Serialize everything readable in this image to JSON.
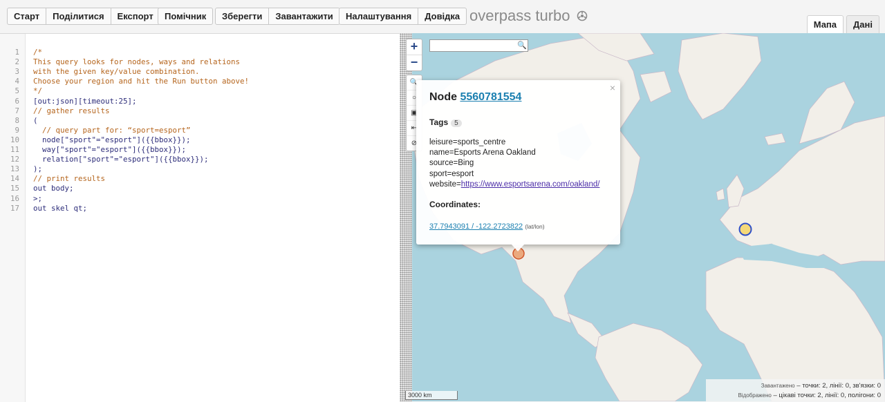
{
  "toolbar": {
    "groups": [
      {
        "buttons": [
          "Старт",
          "Поділитися",
          "Експорт"
        ]
      },
      {
        "buttons": [
          "Помічник"
        ]
      },
      {
        "buttons": [
          "Зберегти",
          "Завантажити"
        ]
      },
      {
        "buttons": [
          "Налаштування",
          "Довідка"
        ]
      }
    ]
  },
  "app": {
    "logo": "overpass turbo",
    "logo_icon": "gear-icon"
  },
  "tabs": {
    "map": "Мапа",
    "data": "Дані",
    "active": "map"
  },
  "editor": {
    "line_numbers": [
      "1",
      "2",
      "3",
      "4",
      "5",
      "6",
      "7",
      "8",
      "9",
      "10",
      "11",
      "12",
      "13",
      "14",
      "15",
      "16",
      "17"
    ],
    "lines": [
      "/*",
      "This query looks for nodes, ways and relations",
      "with the given key/value combination.",
      "Choose your region and hit the Run button above!",
      "*/",
      "[out:json][timeout:25];",
      "// gather results",
      "(",
      "  // query part for: “sport=esport”",
      "  node[\"sport\"=\"esport\"]({{bbox}});",
      "  way[\"sport\"=\"esport\"]({{bbox}});",
      "  relation[\"sport\"=\"esport\"]({{bbox}});",
      ");",
      "// print results",
      "out body;",
      ">;",
      "out skel qt;"
    ]
  },
  "map": {
    "zoom_in": "+",
    "zoom_out": "−",
    "search": {
      "value": "",
      "placeholder": ""
    },
    "tools": [
      "search-icon",
      "locate-icon",
      "image-icon",
      "fit-icon",
      "clear-icon"
    ],
    "scale": "3000 km",
    "popup": {
      "title_prefix": "Node",
      "node_id": "5560781554",
      "tags_label": "Tags",
      "tags_count": "5",
      "tags": [
        "leisure=sports_centre",
        "name=Esports Arena Oakland",
        "source=Bing",
        "sport=esport"
      ],
      "website_key": "website=",
      "website_url": "https://www.esportsarena.com/oakland/",
      "coordinates_label": "Coordinates:",
      "coordinates": "37.7943091 / -122.2723822",
      "coordinates_unit": "(lat/lon)",
      "close": "×"
    },
    "stats": {
      "loaded_label": "Завантажено",
      "loaded_value": "– точки: 2, лінії: 0, зв'язки: 0",
      "shown_label": "Відображено",
      "shown_value": "– цікаві точки: 2, лінії: 0, полігони: 0"
    }
  },
  "colors": {
    "water": "#aad3df",
    "land": "#f2efe9",
    "marker_us": "#e8915a",
    "marker_eu": "#f5d97a",
    "marker_eu_border": "#3050c8"
  }
}
